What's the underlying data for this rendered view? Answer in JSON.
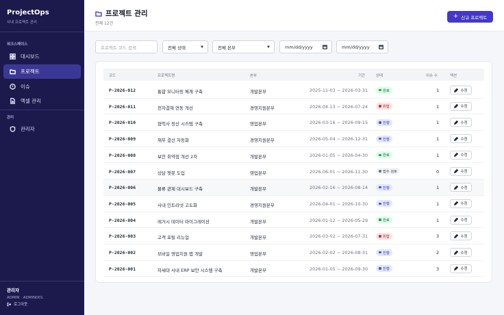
{
  "app": {
    "title": "ProjectOps",
    "subtitle": "사내 프로젝트 관리"
  },
  "sidebar": {
    "section_workspace": "워크스페이스",
    "items": [
      {
        "label": "대시보드",
        "icon": "dashboard-icon"
      },
      {
        "label": "프로젝트",
        "icon": "folder-icon",
        "active": true
      },
      {
        "label": "이슈",
        "icon": "alert-circle-icon"
      },
      {
        "label": "엑셀 관리",
        "icon": "file-icon"
      }
    ],
    "section_admin": "관리",
    "admin_items": [
      {
        "label": "관리자",
        "icon": "shield-icon"
      }
    ],
    "user": {
      "name": "관리자",
      "id": "ADMIN · ADMIN001"
    },
    "logout_label": "로그아웃"
  },
  "header": {
    "title": "프로젝트 관리",
    "count": "전체 12건",
    "new_button": "신규 프로젝트",
    "accent": "#4338ca"
  },
  "filters": {
    "search_placeholder": "프로젝트 코드 검색",
    "status": "전체 상태",
    "division": "전체 본부",
    "date_from": "mm/dd/yyyy",
    "date_to": "mm/dd/yyyy"
  },
  "table": {
    "columns": [
      "코드",
      "프로젝트명",
      "본부",
      "기간",
      "상태",
      "이슈 수",
      "액션"
    ],
    "edit_label": "수정",
    "rows": [
      {
        "code": "P-2026-012",
        "name": "통합 모니터링 체계 구축",
        "division": "개발본부",
        "period": "2025-11-03 ~ 2026-03-31",
        "status": "완료",
        "status_kind": "done",
        "issues": "1"
      },
      {
        "code": "P-2026-011",
        "name": "전자결재 연동 개선",
        "division": "경영지원본부",
        "period": "2026-04-13 ~ 2026-07-24",
        "status": "위험",
        "status_kind": "risk",
        "issues": "1"
      },
      {
        "code": "P-2026-010",
        "name": "협력사 정산 시스템 구축",
        "division": "영업본부",
        "period": "2026-03-16 ~ 2026-09-15",
        "status": "진행",
        "status_kind": "prog",
        "issues": "1"
      },
      {
        "code": "P-2026-009",
        "name": "재무 결산 자동화",
        "division": "경영지원본부",
        "period": "2026-05-04 ~ 2026-12-31",
        "status": "진행",
        "status_kind": "prog",
        "issues": "1"
      },
      {
        "code": "P-2026-008",
        "name": "보안 취약점 개선 2차",
        "division": "개발본부",
        "period": "2026-01-05 ~ 2026-04-30",
        "status": "완료",
        "status_kind": "done",
        "issues": "1"
      },
      {
        "code": "P-2026-007",
        "name": "상담 챗봇 도입",
        "division": "영업본부",
        "period": "2026-06-01 ~ 2026-11-30",
        "status": "접수 검토",
        "status_kind": "rev",
        "issues": "0"
      },
      {
        "code": "P-2026-006",
        "name": "물류 관제 대시보드 구축",
        "division": "개발본부",
        "period": "2026-02-16 ~ 2026-08-14",
        "status": "진행",
        "status_kind": "prog",
        "issues": "1",
        "highlight": true
      },
      {
        "code": "P-2026-005",
        "name": "사내 인트라넷 고도화",
        "division": "경영지원본부",
        "period": "2026-04-01 ~ 2026-10-30",
        "status": "진행",
        "status_kind": "prog",
        "issues": "1"
      },
      {
        "code": "P-2026-004",
        "name": "레거시 데이터 마이그레이션",
        "division": "개발본부",
        "period": "2026-01-12 ~ 2026-05-29",
        "status": "완료",
        "status_kind": "done",
        "issues": "1"
      },
      {
        "code": "P-2026-003",
        "name": "고객 포털 리뉴얼",
        "division": "개발본부",
        "period": "2026-03-02 ~ 2026-07-31",
        "status": "위험",
        "status_kind": "risk",
        "issues": "3"
      },
      {
        "code": "P-2026-002",
        "name": "모바일 영업지원 앱 개발",
        "division": "영업본부",
        "period": "2026-02-02 ~ 2026-08-31",
        "status": "진행",
        "status_kind": "prog",
        "issues": "2"
      },
      {
        "code": "P-2026-001",
        "name": "차세대 사내 ERP 보안 시스템 구축",
        "division": "개발본부",
        "period": "2026-01-05 ~ 2026-09-30",
        "status": "진행",
        "status_kind": "prog",
        "issues": "3"
      }
    ]
  }
}
